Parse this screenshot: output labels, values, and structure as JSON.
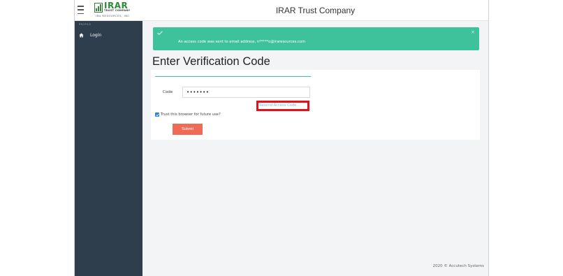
{
  "app": {
    "title": "IRAR Trust Company"
  },
  "logo": {
    "wordmark": "IRAR",
    "tagline": "TRUST COMPANY",
    "company": "IRA RESOURCES, INC"
  },
  "sidebar": {
    "section_label": "PROFILE",
    "items": [
      {
        "label": "Login",
        "icon": "home-icon"
      }
    ]
  },
  "alert": {
    "message": "An access code was sent to email address, n*****o@iraresources.com",
    "close_symbol": "×",
    "color": "#3ec29b"
  },
  "page": {
    "title": "Enter Verification Code"
  },
  "form": {
    "code_label": "Code",
    "code_value": "•••••••",
    "resend_label": "Resend Access Code...",
    "trust_label": "Trust this browser for future use?",
    "trust_checked": true,
    "submit_label": "Submit",
    "submit_color": "#f06b55"
  },
  "footer": {
    "text": "2020 © Accutech Systems"
  },
  "colors": {
    "sidebar": "#2e3e4c",
    "accent": "#3ec29b",
    "highlight": "#e0121b"
  }
}
